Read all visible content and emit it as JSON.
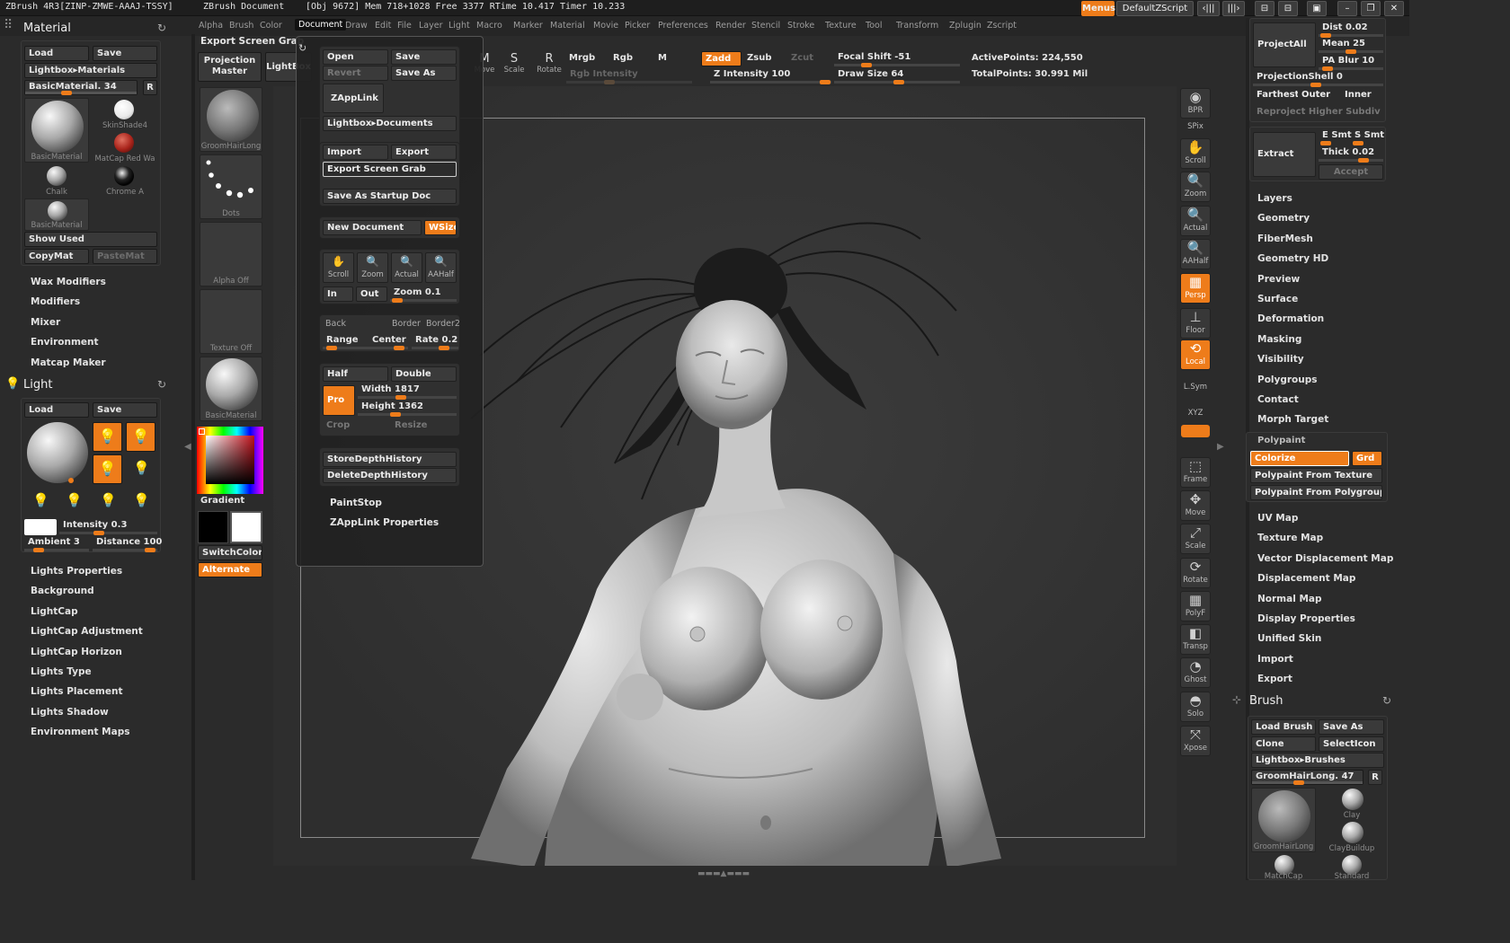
{
  "titlebar": {
    "app": "ZBrush 4R3[ZINP-ZMWE-AAAJ-TSSY]",
    "doc": "ZBrush Document",
    "stats": "[Obj 9672] Mem 718+1028 Free 3377 RTime 10.417 Timer 10.233",
    "menus_btn": "Menus",
    "script": "DefaultZScript"
  },
  "menubar": [
    "Alpha",
    "Brush",
    "Color",
    "Document",
    "Draw",
    "Edit",
    "File",
    "Layer",
    "Light",
    "Macro",
    "Marker",
    "Material",
    "Movie",
    "Picker",
    "Preferences",
    "Render",
    "Stencil",
    "Stroke",
    "Texture",
    "Tool",
    "Transform",
    "Zplugin",
    "Zscript"
  ],
  "menubar_active": "Document",
  "material": {
    "title": "Material",
    "load": "Load",
    "save": "Save",
    "lightbox": "Lightbox▸Materials",
    "slider": "BasicMaterial. 34",
    "r": "R",
    "thumbs": [
      "BasicMaterial",
      "SkinShade4",
      "MatCap Red Wa",
      "Chalk",
      "Chrome A",
      "BasicMaterial"
    ],
    "show_used": "Show Used",
    "copy": "CopyMat",
    "paste": "PasteMat",
    "subitems": [
      "Wax Modifiers",
      "Modifiers",
      "Mixer",
      "Environment",
      "Matcap Maker"
    ]
  },
  "light": {
    "title": "Light",
    "load": "Load",
    "save": "Save",
    "intensity": "Intensity 0.3",
    "ambient": "Ambient 3",
    "distance": "Distance 100",
    "subitems": [
      "Lights Properties",
      "Background",
      "LightCap",
      "LightCap Adjustment",
      "LightCap Horizon",
      "Lights Type",
      "Lights Placement",
      "Lights Shadow",
      "Environment Maps"
    ]
  },
  "shelf": {
    "export_title": "Export Screen Grab",
    "projection": "Projection Master",
    "lightbox": "LightBox",
    "brush_thumb": "GroomHairLong",
    "stroke_thumb": "Dots",
    "alpha_thumb": "Alpha Off",
    "texture_thumb": "Texture Off",
    "material_thumb": "BasicMaterial",
    "gradient": "Gradient",
    "switchcolor": "SwitchColor",
    "alternate": "Alternate"
  },
  "document_menu": {
    "open": "Open",
    "save": "Save",
    "revert": "Revert",
    "save_as": "Save As",
    "zapplink": "ZAppLink",
    "lightbox_docs": "Lightbox▸Documents",
    "import": "Import",
    "export": "Export",
    "export_grab": "Export Screen Grab",
    "startup": "Save As Startup Doc",
    "new_doc": "New Document",
    "wsize": "WSize",
    "nav": [
      "Scroll",
      "Zoom",
      "Actual",
      "AAHalf"
    ],
    "in": "In",
    "out": "Out",
    "zoom_val": "Zoom 0.1",
    "back": "Back",
    "border": "Border",
    "border2": "Border2",
    "range": "Range",
    "center": "Center",
    "rate": "Rate 0.2",
    "half": "Half",
    "double": "Double",
    "pro": "Pro",
    "width": "Width 1817",
    "height": "Height 1362",
    "crop": "Crop",
    "resize": "Resize",
    "store_depth": "StoreDepthHistory",
    "delete_depth": "DeleteDepthHistory",
    "paintstop": "PaintStop",
    "zapplink_props": "ZAppLink Properties"
  },
  "top_toolbar": {
    "move": "Move",
    "scale": "Scale",
    "rotate": "Rotate",
    "mrgb": "Mrgb",
    "rgb": "Rgb",
    "m": "M",
    "rgb_intensity": "Rgb Intensity",
    "zadd": "Zadd",
    "zsub": "Zsub",
    "zcut": "Zcut",
    "z_intensity": "Z Intensity 100",
    "focal": "Focal Shift -51",
    "draw_size": "Draw Size 64",
    "active_points": "ActivePoints: 224,550",
    "total_points": "TotalPoints: 30.991 Mil"
  },
  "right_shelf": [
    {
      "label": "BPR",
      "icon": "bpr-icon",
      "on": false
    },
    {
      "label": "SPix",
      "icon": "",
      "on": false
    },
    {
      "label": "Scroll",
      "icon": "scroll-icon",
      "on": false
    },
    {
      "label": "Zoom",
      "icon": "zoom-icon",
      "on": false
    },
    {
      "label": "Actual",
      "icon": "actual-icon",
      "on": false
    },
    {
      "label": "AAHalf",
      "icon": "aahalf-icon",
      "on": false
    },
    {
      "label": "Persp",
      "icon": "persp-icon",
      "on": true
    },
    {
      "label": "Floor",
      "icon": "floor-icon",
      "on": false
    },
    {
      "label": "Local",
      "icon": "local-icon",
      "on": true
    },
    {
      "label": "L.Sym",
      "icon": "",
      "on": false
    },
    {
      "label": "XYZ",
      "icon": "",
      "on": false
    },
    {
      "label": "Frame",
      "icon": "frame-icon",
      "on": false
    },
    {
      "label": "Move",
      "icon": "move-icon",
      "on": false
    },
    {
      "label": "Scale",
      "icon": "scale-icon",
      "on": false
    },
    {
      "label": "Rotate",
      "icon": "rotate-icon",
      "on": false
    },
    {
      "label": "PolyF",
      "icon": "polyf-icon",
      "on": false
    },
    {
      "label": "Transp",
      "icon": "transp-icon",
      "on": false
    },
    {
      "label": "Ghost",
      "icon": "ghost-icon",
      "on": false
    },
    {
      "label": "Solo",
      "icon": "solo-icon",
      "on": false
    },
    {
      "label": "Xpose",
      "icon": "xpose-icon",
      "on": false
    }
  ],
  "tool_panel": {
    "project_all": "ProjectAll",
    "dist": "Dist 0.02",
    "mean": "Mean 25",
    "pa_blur": "PA Blur 10",
    "projection_shell": "ProjectionShell 0",
    "farthest": "Farthest",
    "outer": "Outer",
    "inner": "Inner",
    "reproject": "Reproject Higher Subdiv",
    "extract": "Extract",
    "e_smt": "E Smt",
    "s_smt": "S Smt",
    "thick": "Thick 0.02",
    "accept": "Accept",
    "subitems_a": [
      "Layers",
      "Geometry",
      "FiberMesh",
      "Geometry HD",
      "Preview",
      "Surface",
      "Deformation",
      "Masking",
      "Visibility",
      "Polygroups",
      "Contact",
      "Morph Target"
    ],
    "polypaint": "Polypaint",
    "colorize": "Colorize",
    "grd": "Grd",
    "pp_texture": "Polypaint From Texture",
    "pp_polygroup": "Polypaint From Polygroup",
    "subitems_b": [
      "UV Map",
      "Texture Map",
      "Vector Displacement Map",
      "Displacement Map",
      "Normal Map",
      "Display Properties",
      "Unified Skin",
      "Import",
      "Export"
    ]
  },
  "brush_panel": {
    "title": "Brush",
    "load": "Load Brush",
    "save_as": "Save As",
    "clone": "Clone",
    "select_icon": "SelectIcon",
    "lightbox": "Lightbox▸Brushes",
    "slider": "GroomHairLong. 47",
    "r": "R",
    "thumbs": [
      "GroomHairLong",
      "Clay",
      "ClayBuildup",
      "MatchCap",
      "Standard"
    ]
  },
  "colors": {
    "accent": "#ee7c1a",
    "bg": "#2b2b2b",
    "canvas": "#343434"
  }
}
